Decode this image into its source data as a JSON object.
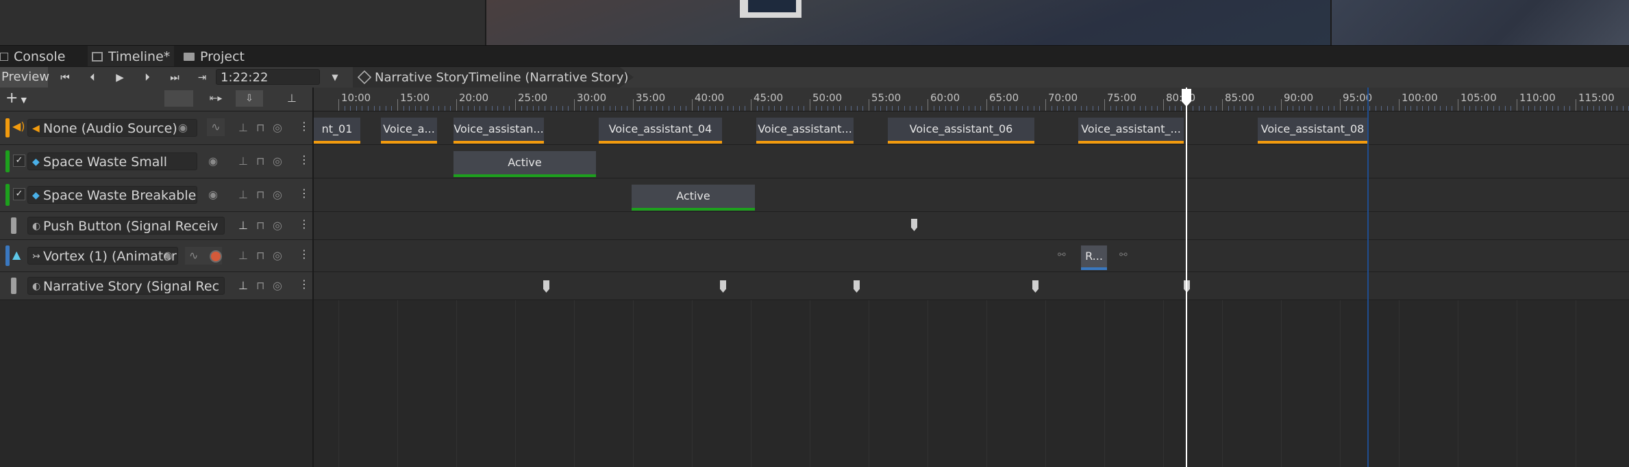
{
  "tabs": [
    {
      "label": "Console",
      "icon": "console-icon"
    },
    {
      "label": "Timeline*",
      "icon": "timeline-icon"
    },
    {
      "label": "Project",
      "icon": "folder-icon"
    }
  ],
  "toolbar": {
    "preview_label": "Preview",
    "time_value": "1:22:22",
    "breadcrumb": "Narrative StoryTimeline (Narrative Story)"
  },
  "ruler": {
    "labels": [
      "10:00",
      "15:00",
      "20:00",
      "25:00",
      "30:00",
      "35:00",
      "40:00",
      "45:00",
      "50:00",
      "55:00",
      "60:00",
      "65:00",
      "70:00",
      "75:00",
      "80:00",
      "85:00",
      "90:00",
      "95:00",
      "100:00",
      "105:00",
      "110:00",
      "115:00"
    ]
  },
  "tracks": [
    {
      "name": "None (Audio Source)",
      "color": "#f29b0e"
    },
    {
      "name": "Space Waste Small",
      "color": "#1da01d"
    },
    {
      "name": "Space Waste Breakable",
      "color": "#1da01d"
    },
    {
      "name": "Push Button (Signal Receiv",
      "color": "#a0a0a0"
    },
    {
      "name": "Vortex (1) (Animator",
      "color": "#3a78c0"
    },
    {
      "name": "Narrative Story (Signal Rec",
      "color": "#a0a0a0"
    }
  ],
  "audio_clips": [
    "nt_01",
    "Voice_a...",
    "Voice_assistan...",
    "Voice_assistant_04",
    "Voice_assistant...",
    "Voice_assistant_06",
    "Voice_assistant_...",
    "Voice_assistant_08"
  ],
  "activation_clips": [
    "Active",
    "Active"
  ],
  "animation_clips": [
    "R..."
  ],
  "playhead_time": "1:22:22"
}
